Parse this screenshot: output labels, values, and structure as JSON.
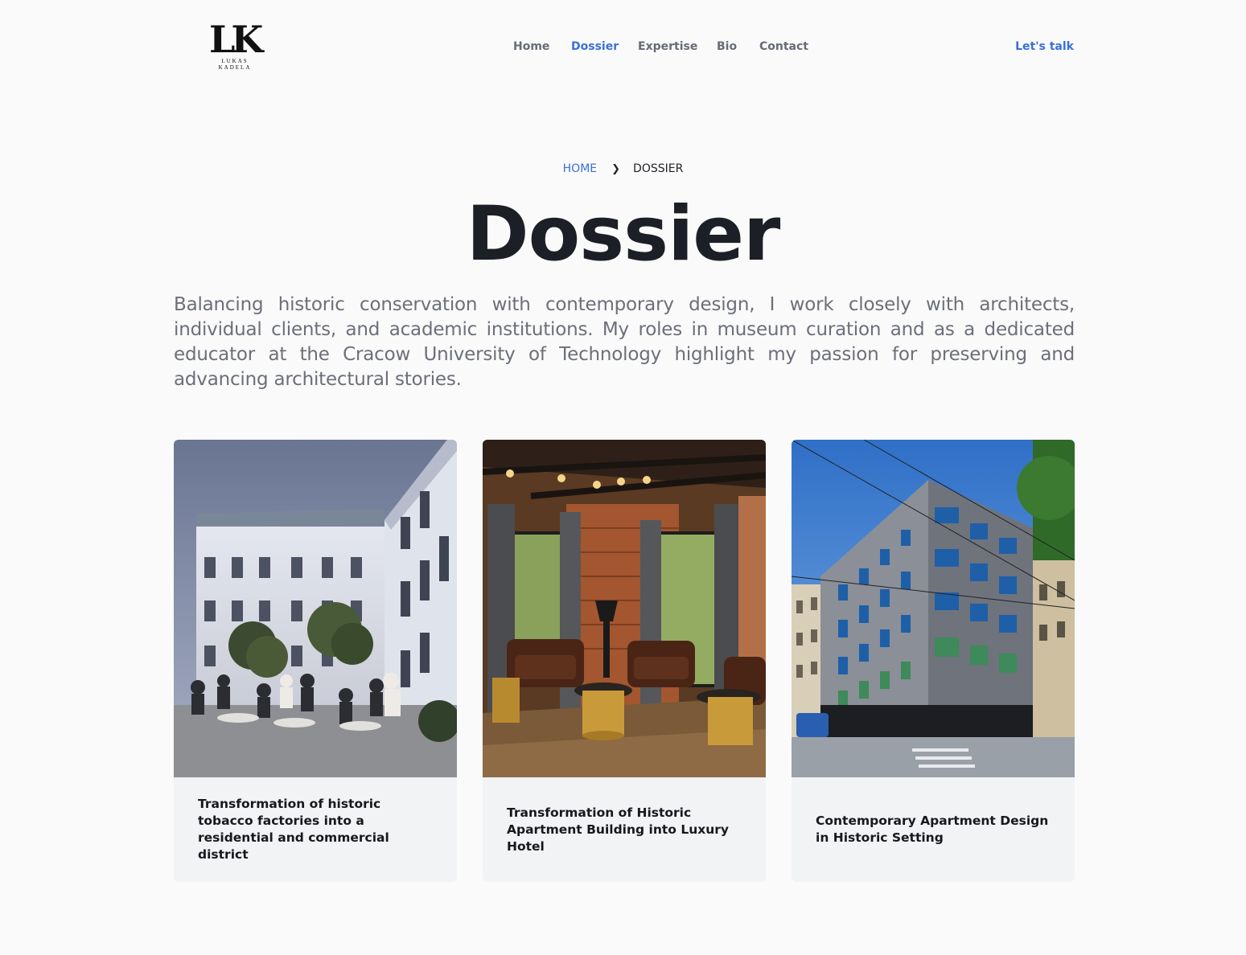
{
  "brand": {
    "initials": "LK",
    "subline": "LUKAS KADELA"
  },
  "nav": {
    "items": [
      {
        "label": "Home",
        "active": false
      },
      {
        "label": "Dossier",
        "active": true
      },
      {
        "label": "Expertise",
        "active": false
      },
      {
        "label": "Bio",
        "active": false
      },
      {
        "label": "Contact",
        "active": false
      }
    ],
    "cta": "Let's talk"
  },
  "breadcrumb": {
    "home": "HOME",
    "current": "DOSSIER"
  },
  "page": {
    "title": "Dossier",
    "intro": "Balancing historic conservation with contemporary design, I work closely with architects, individual clients, and academic institutions. My roles in museum curation and as a dedicated educator at the Cracow University of Technology highlight my passion for preserving and advancing architectural stories."
  },
  "projects": [
    {
      "title": "Transformation of historic tobacco factories into a residential and commercial district",
      "image": "courtyard-cafe-photo"
    },
    {
      "title": "Transformation of Historic Apartment Building into Luxury Hotel",
      "image": "hotel-lounge-photo"
    },
    {
      "title": "Contemporary Apartment Design in Historic Setting",
      "image": "corner-building-photo"
    }
  ],
  "colors": {
    "accent": "#3b6fd8",
    "text": "#1f2128",
    "muted": "#6c6f7b",
    "card_bg": "#f2f3f5",
    "page_bg": "#fafafa"
  }
}
